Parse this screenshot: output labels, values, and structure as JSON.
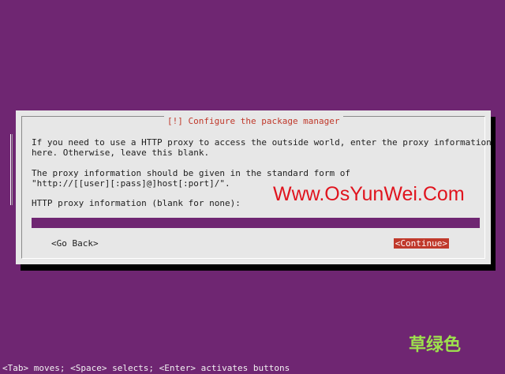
{
  "dialog": {
    "title": "[!] Configure the package manager",
    "paragraph1_line1": "If you need to use a HTTP proxy to access the outside world, enter the proxy information",
    "paragraph1_line2": "here. Otherwise, leave this blank.",
    "paragraph2_line1": "The proxy information should be given in the standard form of",
    "paragraph2_line2": "\"http://[[user][:pass]@]host[:port]/\".",
    "input_label": "HTTP proxy information (blank for none):",
    "input_value": "",
    "back_button": "<Go Back>",
    "continue_button": "<Continue>"
  },
  "watermark": "Www.OsYunWei.Com",
  "corner_logo": "草绿色",
  "status_bar": "<Tab> moves; <Space> selects; <Enter> activates buttons",
  "colors": {
    "background": "#6f2672",
    "dialog": "#e7e7e7",
    "accent": "#c0392b",
    "watermark": "#e0141e",
    "logo": "#9ee04d"
  }
}
